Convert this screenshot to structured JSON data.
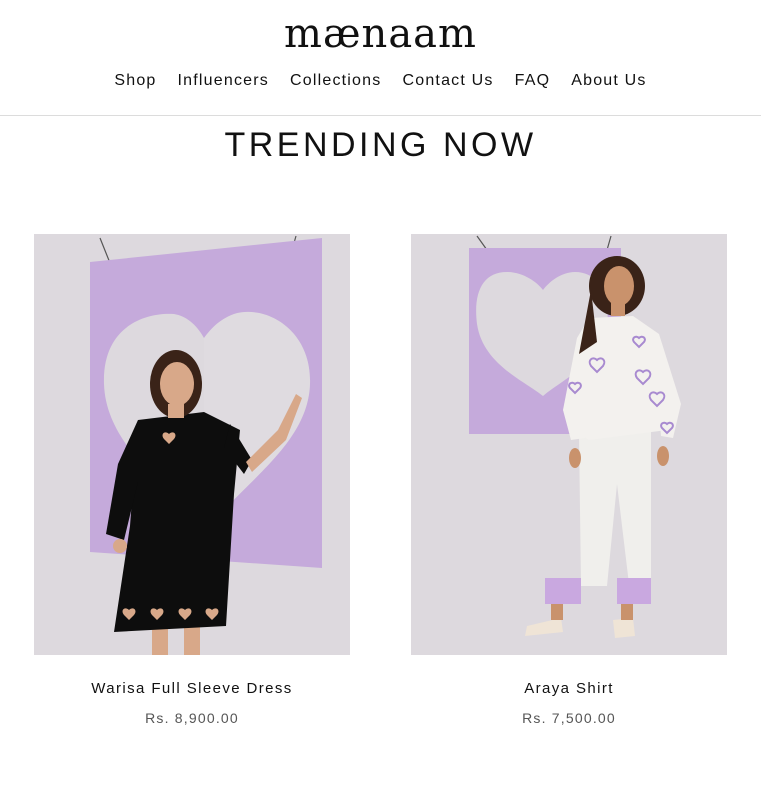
{
  "brand": {
    "logo": "mænaam"
  },
  "nav": {
    "items": [
      "Shop",
      "Influencers",
      "Collections",
      "Contact Us",
      "FAQ",
      "About Us"
    ]
  },
  "section": {
    "title": "TRENDING NOW"
  },
  "products": [
    {
      "name": "Warisa Full Sleeve Dress",
      "price": "Rs. 8,900.00"
    },
    {
      "name": "Araya Shirt",
      "price": "Rs. 7,500.00"
    }
  ],
  "colors": {
    "background": "#ffffff",
    "photo_backdrop": "#ddd9de",
    "lavender_frame": "#c5aadb",
    "dress": "#0d0d0d",
    "shirt": "#f3f1ee"
  }
}
